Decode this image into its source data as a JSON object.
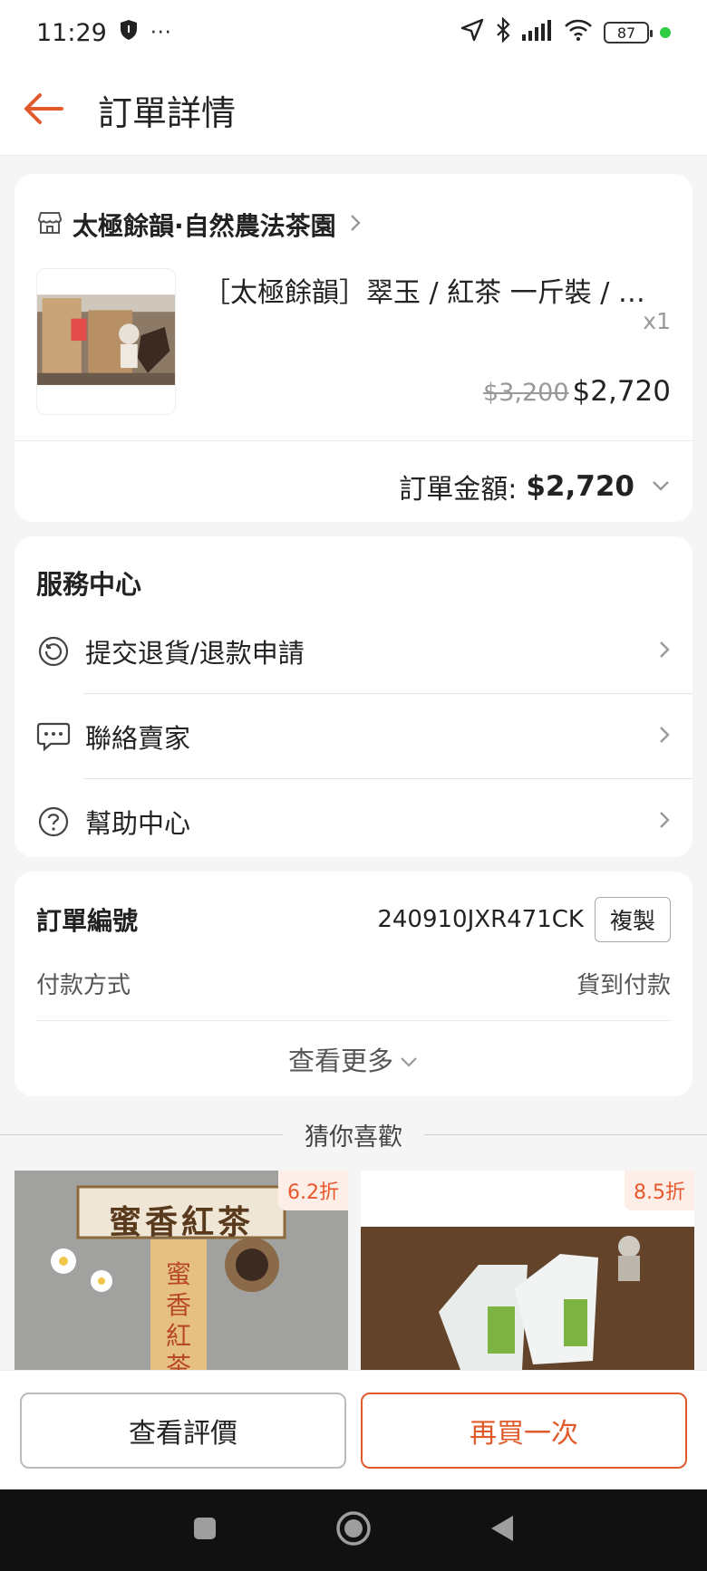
{
  "status_bar": {
    "time": "11:29",
    "more": "···",
    "battery": "87"
  },
  "header": {
    "title": "訂單詳情"
  },
  "order": {
    "shop_name": "太極餘韻·自然農法茶園",
    "product_name": "［太極餘韻］翠玉 / 紅茶 一斤裝 / 茶葉",
    "quantity": "x1",
    "original_price": "$3,200",
    "price": "$2,720",
    "total_label": "訂單金額:",
    "total_value": "$2,720"
  },
  "service": {
    "title": "服務中心",
    "items": [
      {
        "label": "提交退貨/退款申請",
        "icon": "return-icon"
      },
      {
        "label": "聯絡賣家",
        "icon": "chat-icon"
      },
      {
        "label": "幫助中心",
        "icon": "help-icon"
      }
    ]
  },
  "order_info": {
    "number_label": "訂單編號",
    "number_value": "240910JXR471CK",
    "copy_label": "複製",
    "payment_label": "付款方式",
    "payment_value": "貨到付款",
    "more_label": "查看更多"
  },
  "recommend": {
    "title": "猜你喜歡",
    "items": [
      {
        "badge": "6.2折",
        "image_text": "蜜香紅茶",
        "tag_text": "蜜香紅茶"
      },
      {
        "badge": "8.5折"
      }
    ]
  },
  "actions": {
    "review": "查看評價",
    "rebuy": "再買一次"
  },
  "colors": {
    "accent": "#e05a2b",
    "background": "#f5f5f5"
  }
}
